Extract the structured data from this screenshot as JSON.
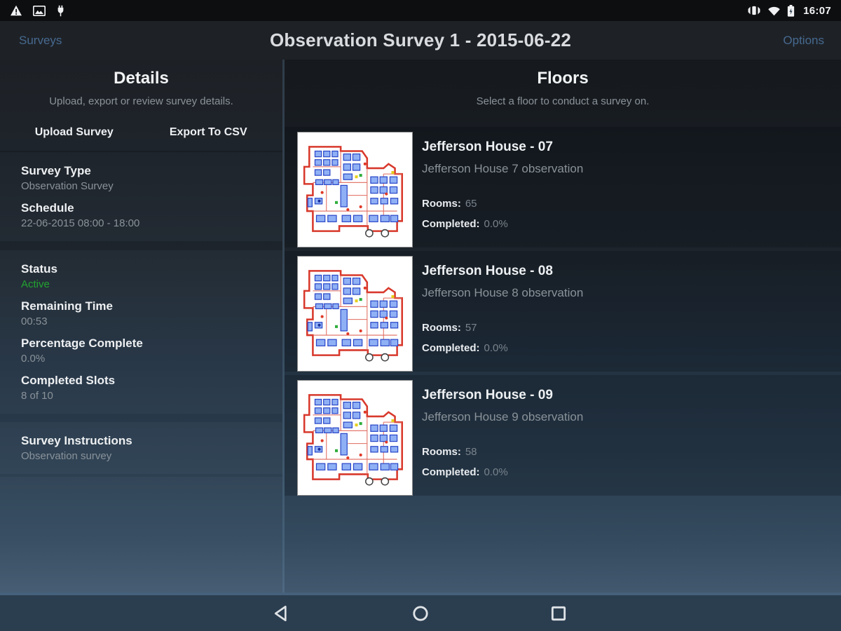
{
  "status_bar": {
    "time": "16:07",
    "left_icons": [
      "warning-icon",
      "image-icon",
      "plug-icon"
    ],
    "right_icons": [
      "vibrate-icon",
      "wifi-icon",
      "battery-charging-icon"
    ]
  },
  "header": {
    "left_link": "Surveys",
    "title": "Observation Survey 1 - 2015-06-22",
    "right_link": "Options",
    "link_color": "#47698f"
  },
  "details": {
    "title": "Details",
    "subtitle": "Upload, export or review survey details.",
    "buttons": [
      {
        "label": "Upload Survey"
      },
      {
        "label": "Export To CSV"
      }
    ],
    "fields": [
      {
        "label": "Survey Type",
        "value": "Observation Survey"
      },
      {
        "label": "Schedule",
        "value": "22-06-2015 08:00 - 18:00"
      }
    ],
    "status_fields": [
      {
        "label": "Status",
        "value": "Active",
        "value_color": "#23a330"
      },
      {
        "label": "Remaining Time",
        "value": "00:53"
      },
      {
        "label": "Percentage Complete",
        "value": "0.0%"
      },
      {
        "label": "Completed Slots",
        "value": "8 of 10"
      }
    ],
    "instructions": {
      "label": "Survey Instructions",
      "value": "Observation survey"
    }
  },
  "floors": {
    "title": "Floors",
    "subtitle": "Select a floor to conduct a survey on.",
    "rooms_label": "Rooms:",
    "completed_label": "Completed:",
    "items": [
      {
        "title": "Jefferson House - 07",
        "subtitle": "Jefferson House 7 observation",
        "rooms": "65",
        "completed": "0.0%"
      },
      {
        "title": "Jefferson House - 08",
        "subtitle": "Jefferson House 8 observation",
        "rooms": "57",
        "completed": "0.0%"
      },
      {
        "title": "Jefferson House - 09",
        "subtitle": "Jefferson House 9 observation",
        "rooms": "58",
        "completed": "0.0%"
      }
    ]
  },
  "nav_bar": {
    "icons": [
      "back-icon",
      "home-icon",
      "recents-icon"
    ]
  }
}
